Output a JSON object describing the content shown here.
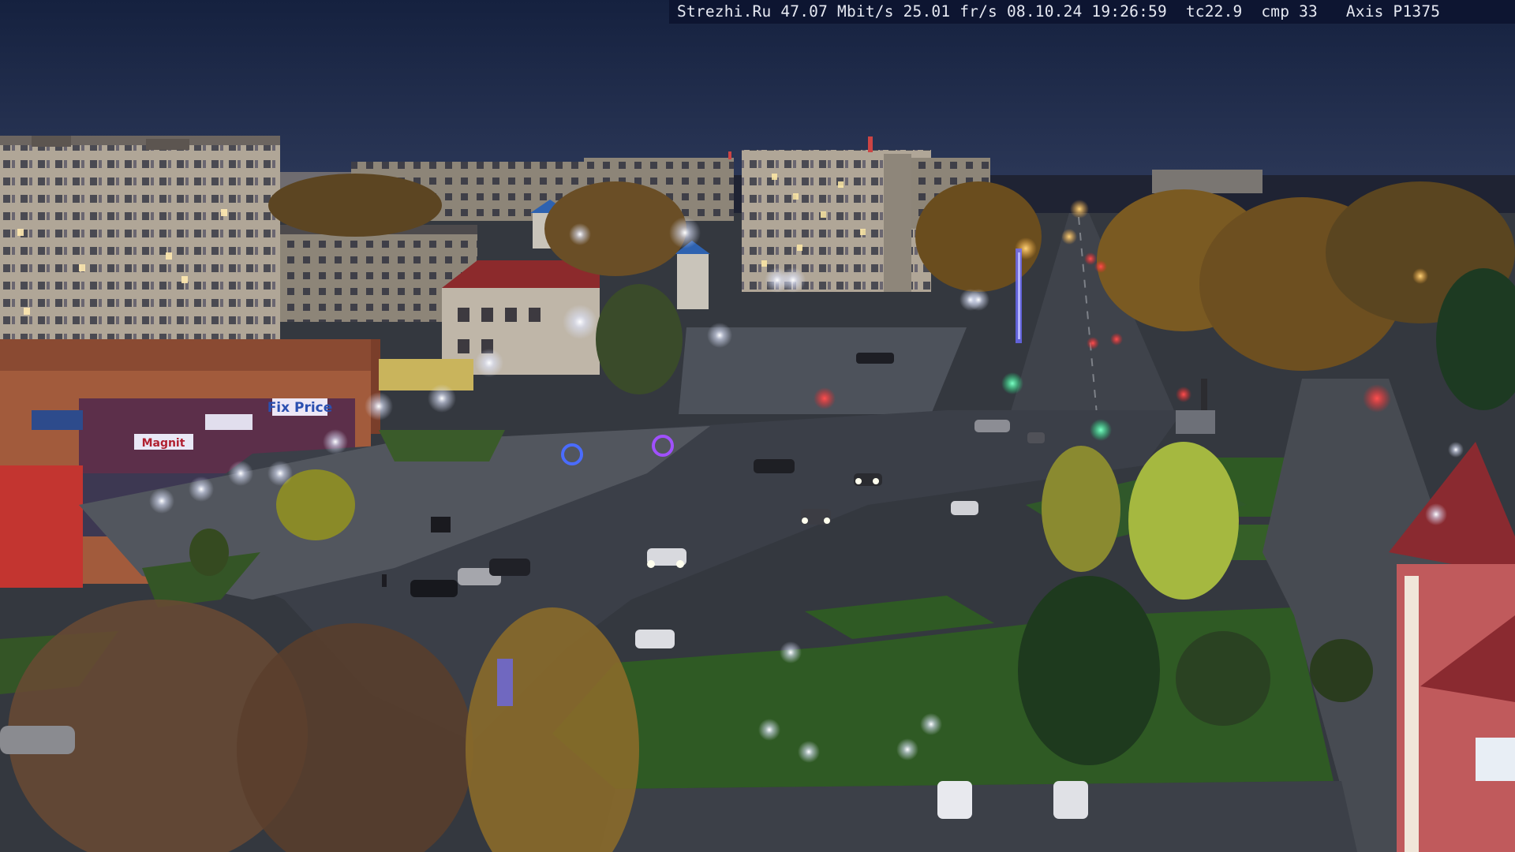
{
  "overlay": {
    "site": "Strezhi.Ru",
    "bitrate": "47.07 Mbit/s",
    "framerate": "25.01 fr/s",
    "datetime": "08.10.24 19:26:59",
    "tc": "tc22.9",
    "cmp": "cmp 33",
    "camera": "Axis P1375"
  },
  "signs": {
    "store_left": "Magnit",
    "store_center": "Fix Price"
  },
  "colors": {
    "sky_top": "#14203d",
    "sky_horizon": "#2a3654",
    "road": "#3b3f48",
    "grass": "#2f5a24",
    "street_light": "#f4f6ff",
    "traffic_red": "#ff2a2a",
    "traffic_green": "#1cff8a"
  }
}
